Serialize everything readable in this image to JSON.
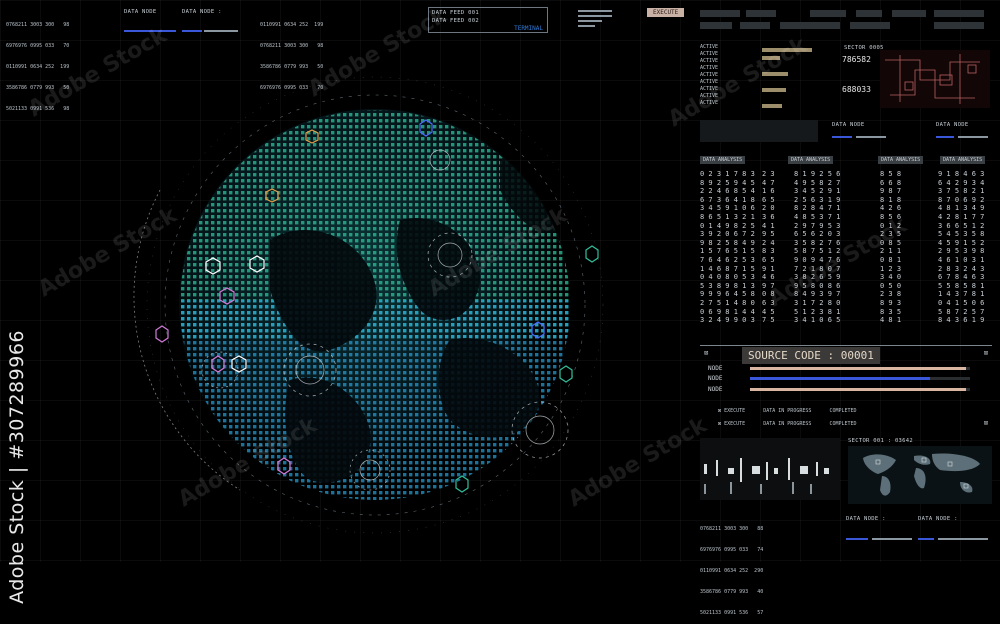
{
  "top_left": {
    "numbers": [
      "0768211 3003 300   98",
      "6976976 0995 033   70",
      "0110991 0634 252  199",
      "3586786 0779 993   50",
      "5021133 0991 536   98"
    ],
    "data_node_label": "DATA NODE",
    "data_node_label_2": "DATA NODE :"
  },
  "top_center": {
    "data_feed_1": "DATA FEED 001",
    "data_feed_2": "DATA FEED 002",
    "terminal": "TERMINAL",
    "execute": "EXECUTE"
  },
  "sector_top": "SECTOR 0005",
  "counter_a": "786582",
  "counter_b": "688033",
  "data_analysis_label": "DATA ANALYSIS",
  "source_code": {
    "title": "SOURCE CODE : 00001",
    "nodes": [
      {
        "label": "NODE",
        "fill": 0.98,
        "color": "#d9b6a2"
      },
      {
        "label": "NODE",
        "fill": 0.82,
        "color": "#3b57d9"
      },
      {
        "label": "NODE",
        "fill": 0.98,
        "color": "#d9b6a2"
      }
    ],
    "execute": "EXECUTE",
    "in_progress": "DATA IN PROGRESS",
    "completed": "COMPLETED"
  },
  "sector_bottom": "SECTOR 001 : 03642",
  "bottom_right": {
    "numbers": [
      "0768211 3003 300   88",
      "6976976 0995 033   74",
      "0110991 0634 252  290",
      "3586786 0779 993   40",
      "5021133 0991 536   57"
    ],
    "data_node_1": "DATA NODE :",
    "data_node_2": "DATA NODE :"
  },
  "watermark": "Adobe Stock",
  "stock_id": "Adobe Stock | #307289966",
  "colors": {
    "green": "#2fbf7a",
    "teal": "#20b7c8",
    "blue": "#3b57d9",
    "pink": "#d07ad8",
    "orange": "#e8a04a",
    "salmon": "#d9b6a2"
  }
}
